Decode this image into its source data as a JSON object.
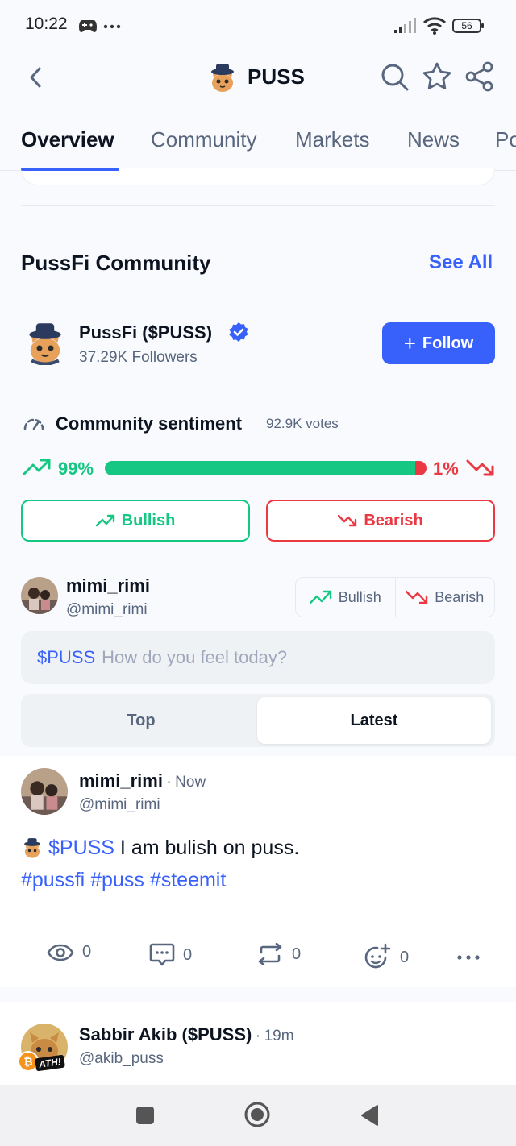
{
  "status": {
    "time": "10:22",
    "battery": "56"
  },
  "header": {
    "title": "PUSS"
  },
  "tabs": [
    "Overview",
    "Community",
    "Markets",
    "News",
    "Po"
  ],
  "community": {
    "section_title": "PussFi Community",
    "see_all": "See All",
    "name": "PussFi ($PUSS)",
    "followers": "37.29K Followers",
    "follow_label": "Follow",
    "follow_plus": "+"
  },
  "sentiment": {
    "title": "Community sentiment",
    "votes": "92.9K votes",
    "bullish_pct_label": "99%",
    "bearish_pct_label": "1%",
    "bullish_fraction": 0.99,
    "bullish_label": "Bullish",
    "bearish_label": "Bearish",
    "colors": {
      "bullish": "#16c784",
      "bearish": "#ea3943",
      "accent": "#3861fb"
    }
  },
  "composer": {
    "user_name": "mimi_rimi",
    "user_handle": "@mimi_rimi",
    "toggle_bullish": "Bullish",
    "toggle_bearish": "Bearish",
    "ticker": "$PUSS",
    "placeholder": "How do you feel today?"
  },
  "feed_tabs": {
    "top": "Top",
    "latest": "Latest"
  },
  "post1": {
    "author": "mimi_rimi",
    "separator": "·",
    "time": "Now",
    "handle": "@mimi_rimi",
    "ticker": "$PUSS",
    "text": " I am bulish on puss.",
    "hashtags": "#pussfi #puss #steemit",
    "views": "0",
    "comments": "0",
    "reposts": "0",
    "reactions": "0"
  },
  "post2": {
    "author": "Sabbir Akib ($PUSS)",
    "separator": "·",
    "time": "19m",
    "handle": "@akib_puss",
    "badge": "ATH!"
  }
}
